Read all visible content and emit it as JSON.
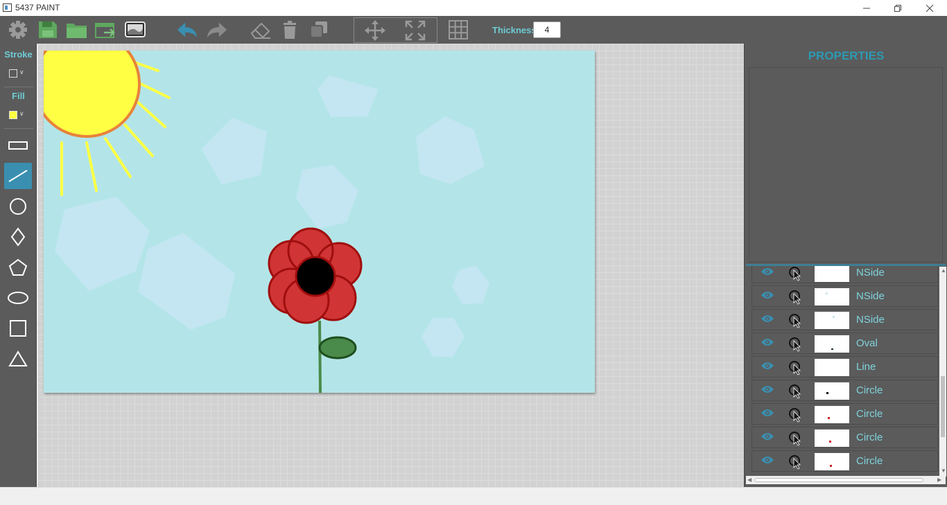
{
  "window": {
    "title": "5437 PAINT"
  },
  "toolbar": {
    "thickness_label": "Thickness",
    "thickness_value": "4",
    "buttons": [
      "gear-icon",
      "save-icon",
      "open-folder-icon",
      "export-icon",
      "image-icon",
      "undo-icon",
      "redo-icon",
      "eraser-icon",
      "trash-icon",
      "duplicate-icon",
      "move-icon",
      "fit-screen-icon",
      "grid-icon"
    ]
  },
  "left_panel": {
    "stroke_label": "Stroke",
    "fill_label": "Fill",
    "stroke_color": "#5b5b5b",
    "fill_color": "#ffff44",
    "active_tool": "line",
    "tools": [
      "rectangle-outline",
      "line",
      "circle",
      "diamond",
      "pentagon",
      "ellipse",
      "square",
      "triangle"
    ]
  },
  "properties": {
    "title": "PROPERTIES"
  },
  "layers": [
    {
      "name": "NSide",
      "thumb_mark_color": "#cce8ee"
    },
    {
      "name": "NSide",
      "thumb_mark_color": "#cce8ee"
    },
    {
      "name": "NSide",
      "thumb_mark_color": "#cce8ee"
    },
    {
      "name": "Oval",
      "thumb_mark_color": "#1a3a1a"
    },
    {
      "name": "Line",
      "thumb_mark_color": "#ffffff"
    },
    {
      "name": "Circle",
      "thumb_mark_color": "#000000"
    },
    {
      "name": "Circle",
      "thumb_mark_color": "#cc2222"
    },
    {
      "name": "Circle",
      "thumb_mark_color": "#cc2222"
    },
    {
      "name": "Circle",
      "thumb_mark_color": "#cc2222"
    }
  ],
  "colors": {
    "accent": "#6ecbd4",
    "panel": "#5b5b5b",
    "canvas_bg": "#b3e5e8",
    "sun": "#ffff44",
    "sun_outline": "#e8823a",
    "petal": "#d03434",
    "petal_outline": "#a00e0e",
    "leaf": "#4a8a4a"
  }
}
